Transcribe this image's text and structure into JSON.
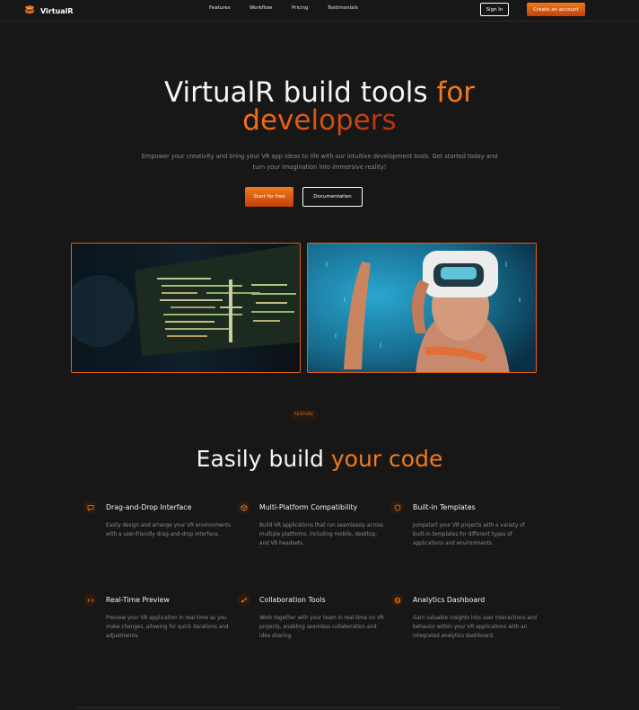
{
  "nav": {
    "brand": "VirtualR",
    "links": [
      "Features",
      "Workflow",
      "Pricing",
      "Testimonials"
    ],
    "sign_in": "Sign In",
    "create_account": "Create an account"
  },
  "hero": {
    "title_main": "VirtualR build tools ",
    "title_accent1": "for",
    "title_accent2": "developers",
    "subtitle": "Empower your creativity and bring your VR app ideas to life with our intuitive development tools. Get started today and turn your imagination into immersive reality!",
    "cta_primary": "Start for free",
    "cta_secondary": "Documentation"
  },
  "features": {
    "badge": "FEATURE",
    "title_main": "Easily build ",
    "title_accent": "your code",
    "items": [
      {
        "icon": "chat-bubble-icon",
        "title": "Drag-and-Drop Interface",
        "desc": "Easily design and arrange your VR environments with a user-friendly drag-and-drop interface."
      },
      {
        "icon": "cube-icon",
        "title": "Multi-Platform Compatibility",
        "desc": "Build VR applications that run seamlessly across multiple platforms, including mobile, desktop, and VR headsets."
      },
      {
        "icon": "shield-icon",
        "title": "Built-in Templates",
        "desc": "Jumpstart your VR projects with a variety of built-in templates for different types of applications and environments."
      },
      {
        "icon": "code-preview-icon",
        "title": "Real-Time Preview",
        "desc": "Preview your VR application in real-time as you make changes, allowing for quick iterations and adjustments."
      },
      {
        "icon": "collaboration-icon",
        "title": "Collaboration Tools",
        "desc": "Work together with your team in real-time on VR projects, enabling seamless collaboration and idea sharing."
      },
      {
        "icon": "globe-icon",
        "title": "Analytics Dashboard",
        "desc": "Gain valuable insights into user interactions and behavior within your VR applications with an integrated analytics dashboard."
      }
    ]
  },
  "colors": {
    "background": "#171717",
    "accent": "#f07a1c",
    "accent_dark": "#c2410c"
  }
}
